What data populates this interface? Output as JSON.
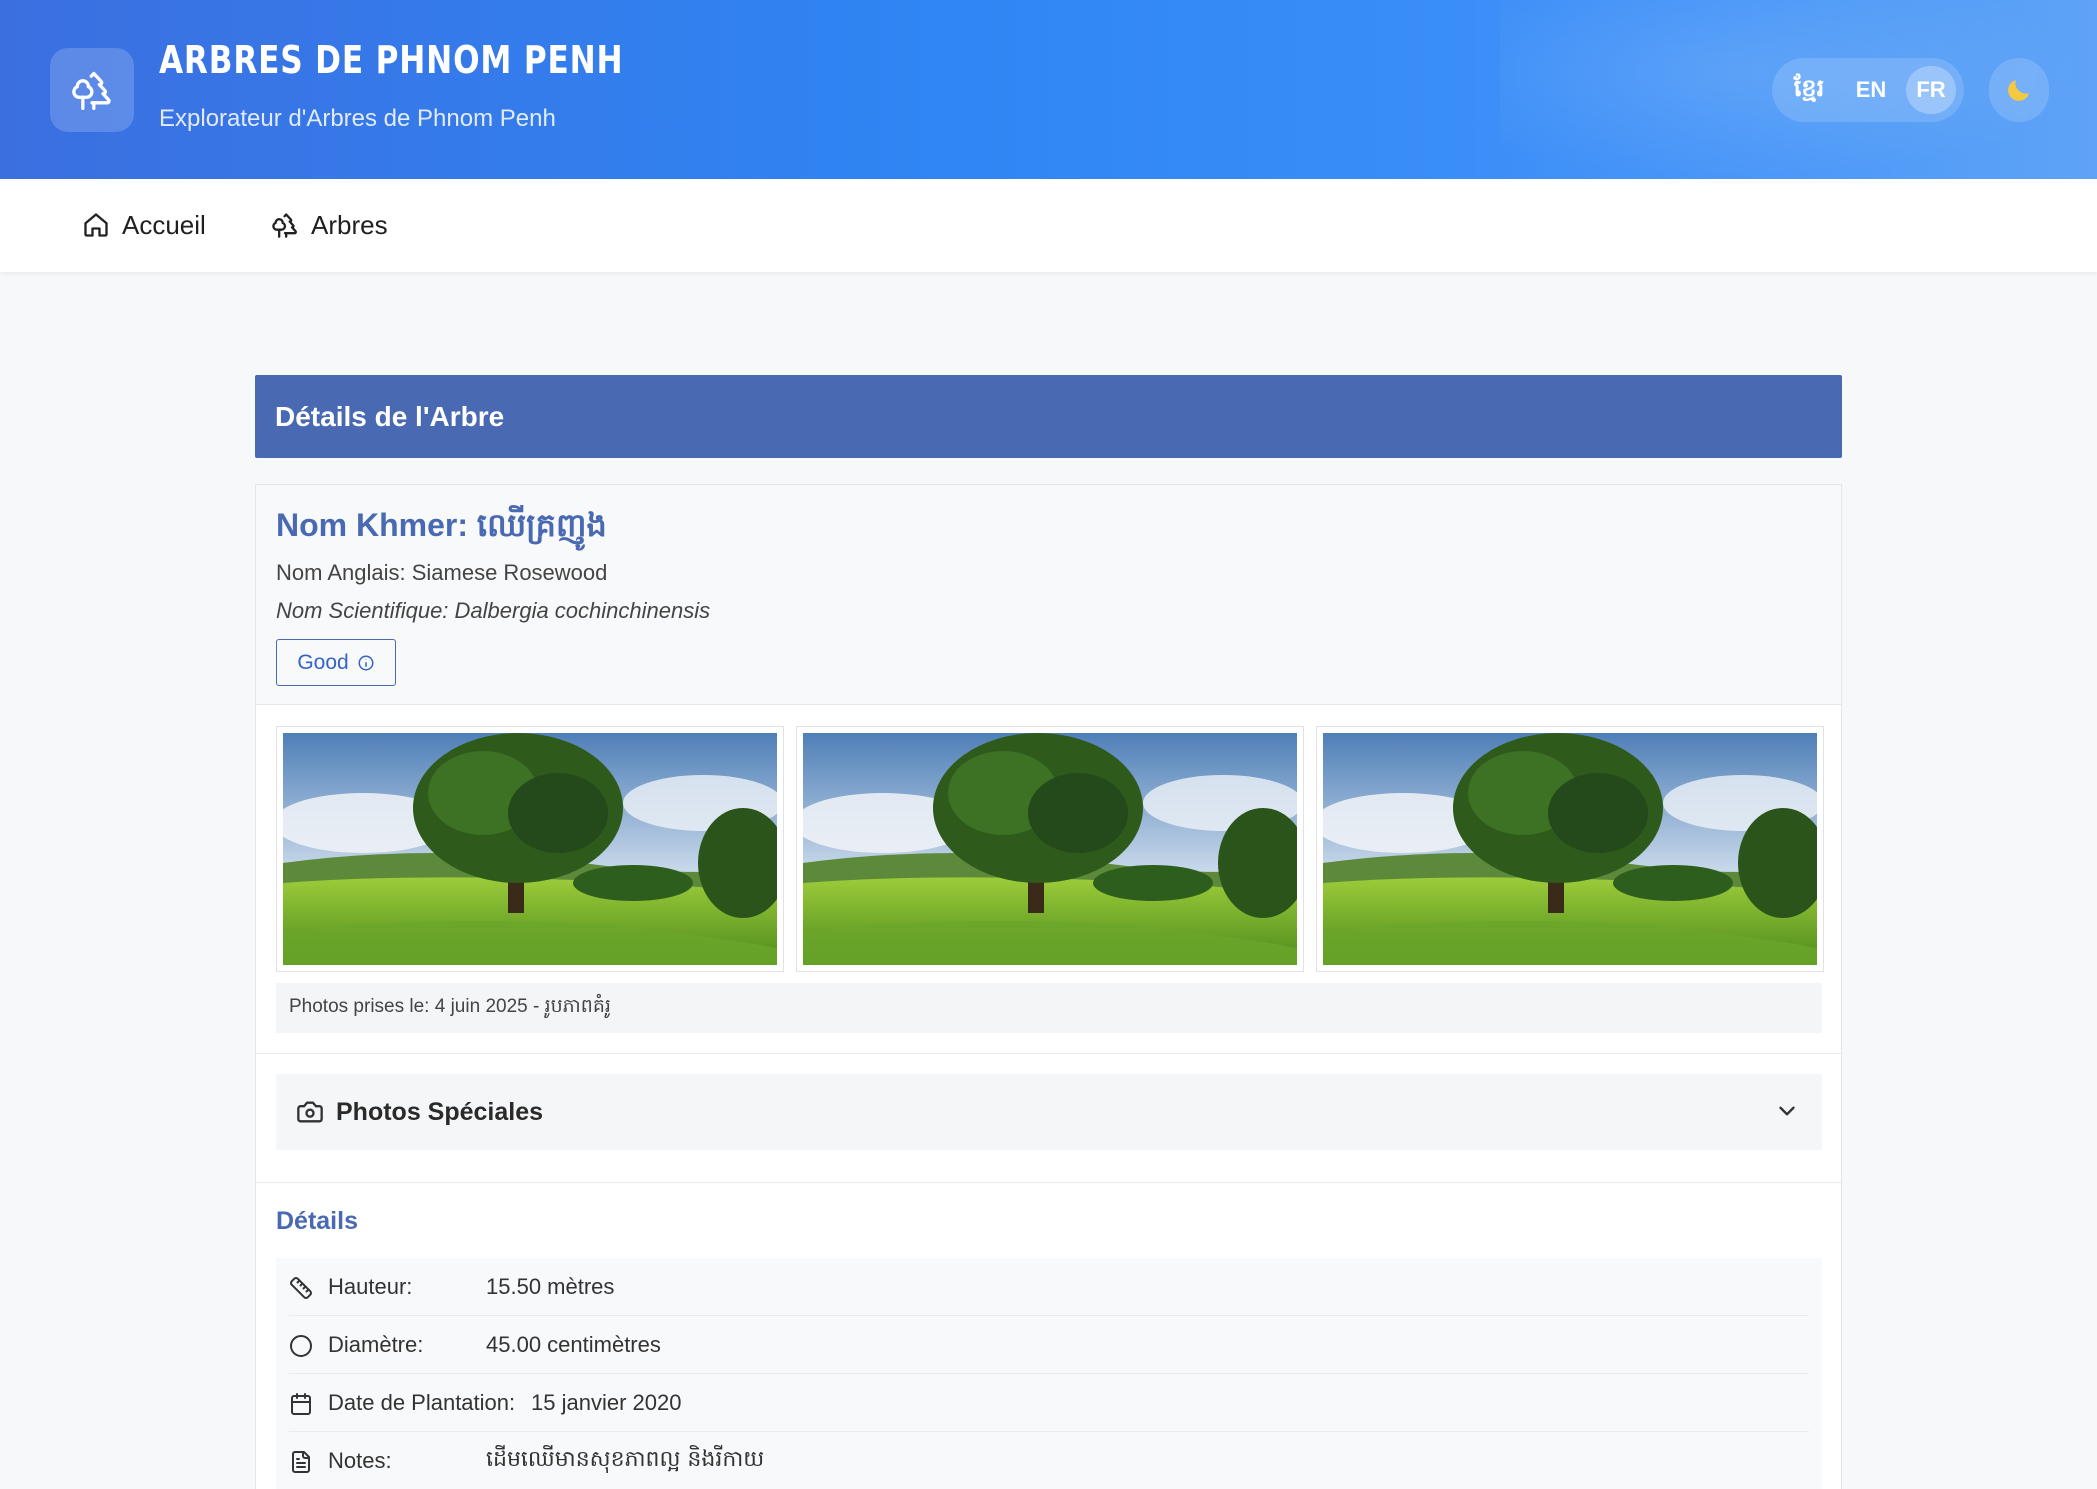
{
  "header": {
    "title": "ARBRES DE PHNOM PENH",
    "subtitle": "Explorateur d'Arbres de Phnom Penh",
    "logo_icon": "trees-icon",
    "languages": [
      "ខ្មែរ",
      "EN",
      "FR"
    ],
    "active_language": "FR",
    "theme_icon": "moon-icon"
  },
  "nav": {
    "items": [
      {
        "label": "Accueil",
        "icon": "home-icon"
      },
      {
        "label": "Arbres",
        "icon": "trees-icon"
      }
    ]
  },
  "section": {
    "title": "Détails de l'Arbre"
  },
  "tree": {
    "khmer_name": "Nom Khmer: ឈើគ្រញូង",
    "english_name": "Nom Anglais: Siamese Rosewood",
    "scientific_name": "Nom Scientifique: Dalbergia cochinchinensis",
    "status_badge": "Good",
    "photo_caption": "Photos prises le: 4 juin 2025 - រូបភាពគំរូ"
  },
  "special_photos": {
    "label": "Photos Spéciales"
  },
  "details": {
    "title": "Détails",
    "rows": [
      {
        "label": "Hauteur:",
        "value": "15.50 mètres",
        "icon": "ruler-icon"
      },
      {
        "label": "Diamètre:",
        "value": "45.00 centimètres",
        "icon": "circle-icon"
      },
      {
        "label": "Date de Plantation:",
        "value": "15 janvier 2020",
        "icon": "calendar-icon"
      },
      {
        "label": "Notes:",
        "value": "ដើមឈើមានសុខភាពល្អ និងរីកាយ",
        "icon": "file-text-icon"
      }
    ]
  },
  "colors": {
    "header_gradient_start": "#3b6fe0",
    "header_gradient_end": "#5ea3f7",
    "section_bar": "#4a69b3",
    "accent_text": "#4a69b3"
  }
}
